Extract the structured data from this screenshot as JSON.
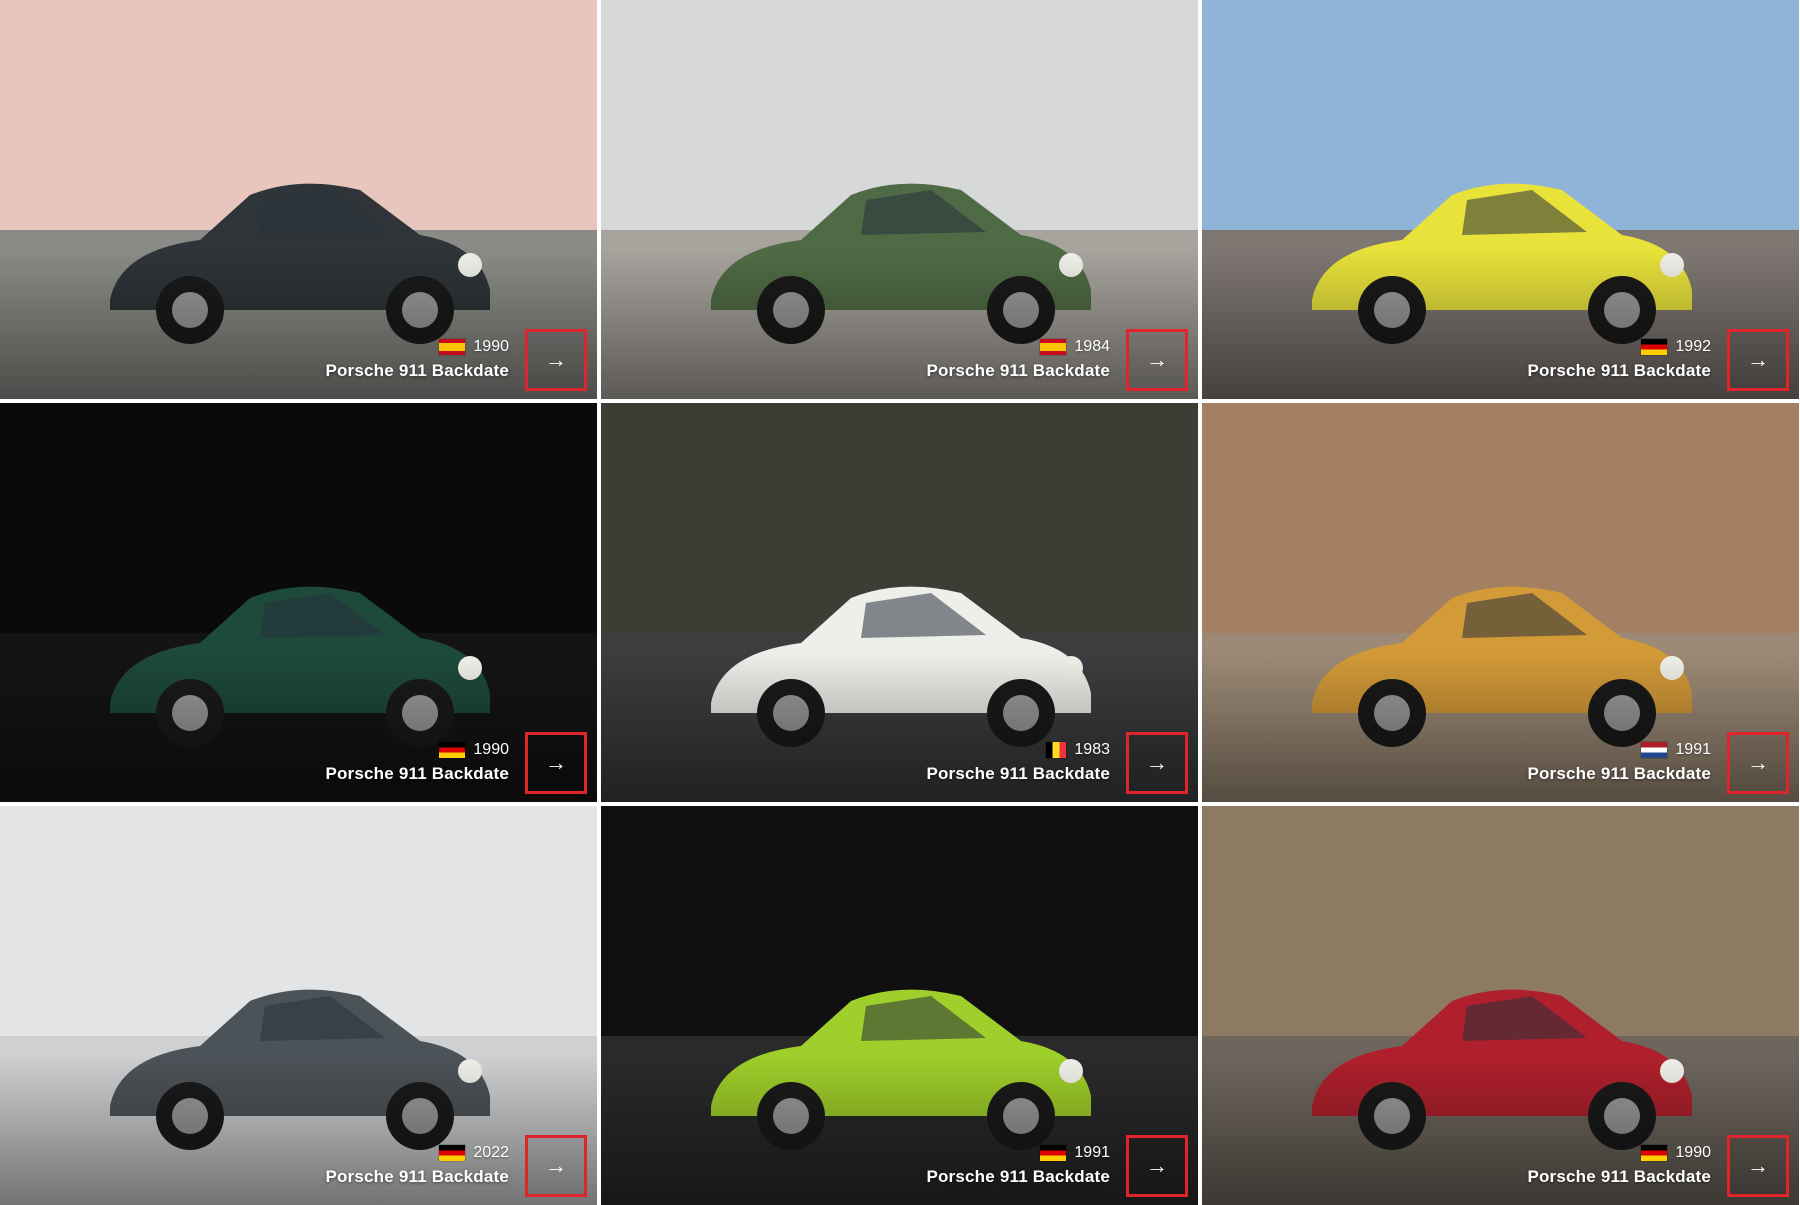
{
  "cards": [
    {
      "year": "1990",
      "country": "es",
      "title": "Porsche 911 Backdate",
      "arrow_icon": "→",
      "sky": "#e9c6bd",
      "ground": "#8a8a86",
      "car": "#2e3438"
    },
    {
      "year": "1984",
      "country": "es",
      "title": "Porsche 911 Backdate",
      "arrow_icon": "→",
      "sky": "#d7d9d8",
      "ground": "#a7a39d",
      "car": "#4f6b45"
    },
    {
      "year": "1992",
      "country": "de",
      "title": "Porsche 911 Backdate",
      "arrow_icon": "→",
      "sky": "#8fb4d8",
      "ground": "#7e7671",
      "car": "#e8e23a"
    },
    {
      "year": "1990",
      "country": "de",
      "title": "Porsche 911 Backdate",
      "arrow_icon": "→",
      "sky": "#0a0a0a",
      "ground": "#141414",
      "car": "#1d4a3a"
    },
    {
      "year": "1983",
      "country": "be",
      "title": "Porsche 911 Backdate",
      "arrow_icon": "→",
      "sky": "#3a3e34",
      "ground": "#3b3d3f",
      "car": "#eeeeea"
    },
    {
      "year": "1991",
      "country": "nl",
      "title": "Porsche 911 Backdate",
      "arrow_icon": "→",
      "sky": "#a38062",
      "ground": "#9c8a76",
      "car": "#d39a38"
    },
    {
      "year": "2022",
      "country": "de",
      "title": "Porsche 911 Backdate",
      "arrow_icon": "→",
      "sky": "#e3e4e6",
      "ground": "#cfd0d2",
      "car": "#4c5358"
    },
    {
      "year": "1991",
      "country": "de",
      "title": "Porsche 911 Backdate",
      "arrow_icon": "→",
      "sky": "#101010",
      "ground": "#2a2a2a",
      "car": "#9fcf2a"
    },
    {
      "year": "1990",
      "country": "de",
      "title": "Porsche 911 Backdate",
      "arrow_icon": "→",
      "sky": "#8d7a62",
      "ground": "#6e665d",
      "car": "#b0202c"
    }
  ]
}
